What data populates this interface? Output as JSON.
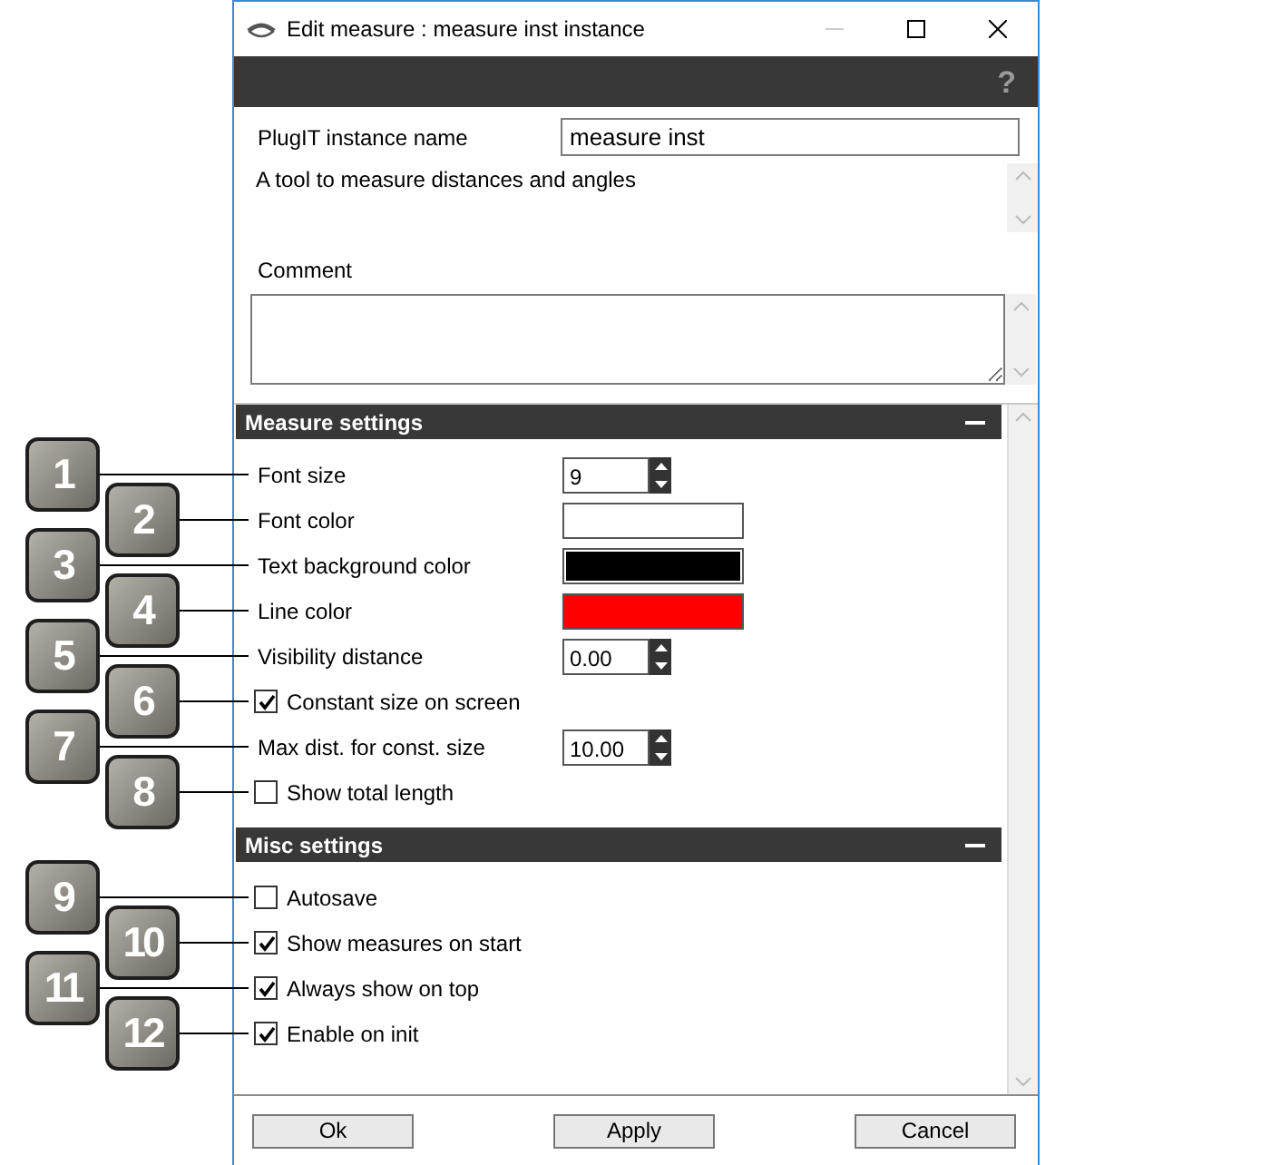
{
  "window": {
    "title": "Edit measure : measure inst instance",
    "help_glyph": "?"
  },
  "instance_name": {
    "label": "PlugIT instance name",
    "value": "measure inst"
  },
  "description": "A tool to measure distances and angles",
  "comment": {
    "label": "Comment"
  },
  "sections": [
    {
      "title": "Measure settings",
      "rows": [
        {
          "kind": "spin",
          "callout": "1",
          "label": "Font size",
          "value": "9"
        },
        {
          "kind": "color",
          "callout": "2",
          "label": "Font color",
          "color": "#ffffff"
        },
        {
          "kind": "color",
          "callout": "3",
          "label": "Text background color",
          "color": "#000000"
        },
        {
          "kind": "color",
          "callout": "4",
          "label": "Line color",
          "color": "#ff0000"
        },
        {
          "kind": "spin",
          "callout": "5",
          "label": "Visibility distance",
          "value": "0.00"
        },
        {
          "kind": "checkbox",
          "callout": "6",
          "label": "Constant size on screen",
          "checked": true
        },
        {
          "kind": "spin",
          "callout": "7",
          "label": "Max dist. for const. size",
          "value": "10.00"
        },
        {
          "kind": "checkbox",
          "callout": "8",
          "label": "Show total length",
          "checked": false
        }
      ]
    },
    {
      "title": "Misc settings",
      "rows": [
        {
          "kind": "checkbox",
          "callout": "9",
          "label": "Autosave",
          "checked": false
        },
        {
          "kind": "checkbox",
          "callout": "10",
          "label": "Show measures on start",
          "checked": true
        },
        {
          "kind": "checkbox",
          "callout": "11",
          "label": "Always show on top",
          "checked": true
        },
        {
          "kind": "checkbox",
          "callout": "12",
          "label": "Enable on init",
          "checked": true
        }
      ]
    }
  ],
  "buttons": [
    "Ok",
    "Apply",
    "Cancel"
  ]
}
